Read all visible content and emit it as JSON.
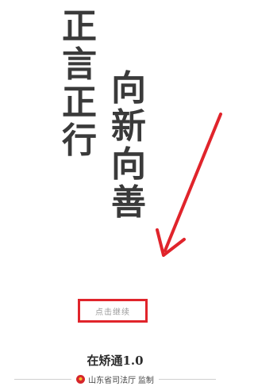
{
  "slogan": {
    "left_column": [
      "正",
      "言",
      "正",
      "行"
    ],
    "right_column": [
      "向",
      "新",
      "向",
      "善"
    ]
  },
  "continue_button": {
    "label": "点击继续"
  },
  "app_name": "在矫通1.0",
  "footer": {
    "org_label": "山东省司法厅 监制"
  },
  "colors": {
    "accent": "#e0242b",
    "slogan_text": "#3a3a3a"
  }
}
